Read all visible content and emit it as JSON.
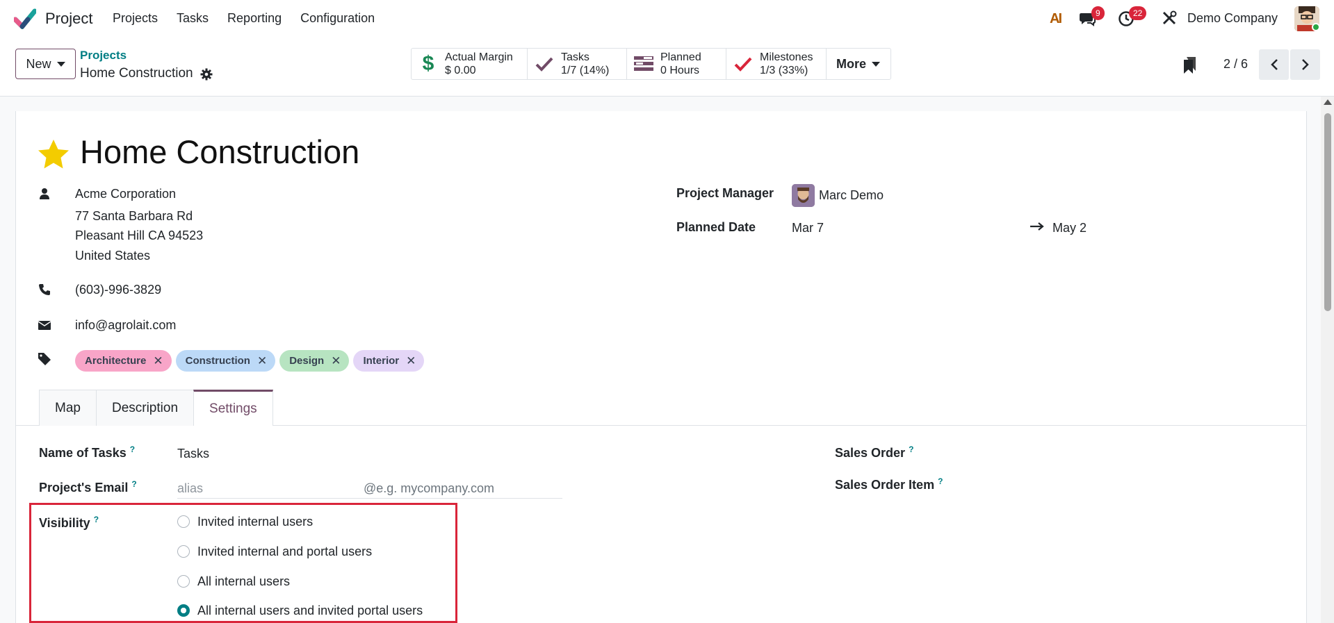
{
  "app": {
    "name": "Project"
  },
  "nav": {
    "items": [
      "Projects",
      "Tasks",
      "Reporting",
      "Configuration"
    ]
  },
  "systray": {
    "chat_count": "9",
    "activity_count": "22",
    "company": "Demo Company"
  },
  "control": {
    "new_label": "New",
    "breadcrumb_parent": "Projects",
    "breadcrumb_current": "Home Construction",
    "pager": "2 / 6",
    "smart_buttons": [
      {
        "label": "Actual Margin",
        "value": "$ 0.00",
        "icon": "dollar-icon"
      },
      {
        "label": "Tasks",
        "value": "1/7 (14%)",
        "icon": "check-icon"
      },
      {
        "label": "Planned",
        "value": "0 Hours",
        "icon": "planning-icon"
      },
      {
        "label": "Milestones",
        "value": "1/3 (33%)",
        "icon": "check-icon"
      }
    ],
    "more_label": "More"
  },
  "form": {
    "title": "Home Construction",
    "customer": {
      "name": "Acme Corporation",
      "street": "77 Santa Barbara Rd",
      "city": "Pleasant Hill CA 94523",
      "country": "United States"
    },
    "phone": "(603)-996-3829",
    "email": "info@agrolait.com",
    "tags": [
      {
        "label": "Architecture",
        "color": "#f8a5c8"
      },
      {
        "label": "Construction",
        "color": "#bcd9f7"
      },
      {
        "label": "Design",
        "color": "#b7e4c1"
      },
      {
        "label": "Interior",
        "color": "#e4d6f7"
      }
    ],
    "project_manager_label": "Project Manager",
    "project_manager": "Marc Demo",
    "planned_date_label": "Planned Date",
    "planned_start": "Mar 7",
    "planned_end": "May 2"
  },
  "tabs": [
    {
      "label": "Map",
      "active": false
    },
    {
      "label": "Description",
      "active": false
    },
    {
      "label": "Settings",
      "active": true
    }
  ],
  "settings": {
    "name_of_tasks_label": "Name of Tasks",
    "name_of_tasks": "Tasks",
    "project_email_label": "Project's Email",
    "alias_placeholder": "alias",
    "domain_placeholder": "@e.g. mycompany.com",
    "sales_order_label": "Sales Order",
    "sales_order_item_label": "Sales Order Item",
    "visibility_label": "Visibility",
    "visibility_options": [
      {
        "label": "Invited internal users",
        "selected": false
      },
      {
        "label": "Invited internal and portal users",
        "selected": false
      },
      {
        "label": "All internal users",
        "selected": false
      },
      {
        "label": "All internal users and invited portal users",
        "selected": true
      }
    ],
    "help_mark": "?"
  },
  "colors": {
    "brand": "#714b67",
    "accent": "#017e84",
    "highlight": "#d9253a"
  }
}
